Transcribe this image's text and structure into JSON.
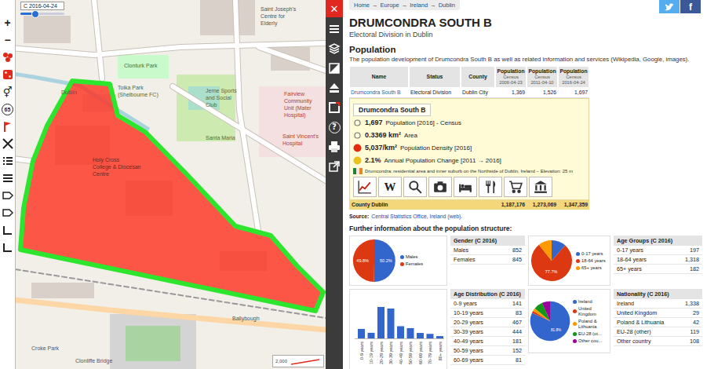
{
  "map": {
    "time_label": "C 2016-04-24",
    "time_level": 0.32,
    "inset_tick": "2,000",
    "tools": [
      {
        "kind": "zoom-in",
        "glyph": "+"
      },
      {
        "kind": "zoom-out",
        "glyph": "−"
      },
      {
        "kind": "markers"
      },
      {
        "kind": "grid"
      },
      {
        "kind": "gender",
        "glyph": "⚥"
      },
      {
        "kind": "age",
        "glyph": "65"
      },
      {
        "kind": "flag"
      },
      {
        "kind": "expand"
      },
      {
        "kind": "list"
      },
      {
        "kind": "menu"
      },
      {
        "kind": "tag"
      },
      {
        "kind": "tag"
      },
      {
        "kind": "corner"
      },
      {
        "kind": "corner"
      }
    ],
    "labels": [
      {
        "lines": [
          "Saint Joseph's",
          "Centre for",
          "Elderly"
        ],
        "color": "#555555"
      },
      {
        "lines": [
          "Clonturk Park"
        ],
        "color": "#4d6b4d"
      },
      {
        "lines": [
          "Tolka Park",
          "(Shelbourne FC)"
        ],
        "color": "#4d6b4d"
      },
      {
        "lines": [
          "Jerne Sports",
          "and Social",
          "Club"
        ],
        "color": "#4d6b4d"
      },
      {
        "lines": [
          "Fairview",
          "Community",
          "Unit (Mater",
          "Hospital)"
        ],
        "color": "#b0403a"
      },
      {
        "lines": [
          "Saint Vincent's",
          "Hospital"
        ],
        "color": "#b0403a"
      },
      {
        "lines": [
          "Santa Maria"
        ],
        "color": "#4d6b4d"
      },
      {
        "lines": [
          "Holy Cross",
          "College & Diocesan",
          "Centre"
        ],
        "color": "#6b2a20"
      },
      {
        "lines": [
          "Dublin"
        ],
        "color": "#555555"
      },
      {
        "lines": [
          "Croke Park"
        ],
        "color": "#555555"
      },
      {
        "lines": [
          "Clonliffe Bridge"
        ],
        "color": "#555555"
      },
      {
        "lines": [
          "Ballybough"
        ],
        "color": "#555555"
      }
    ]
  },
  "sidebar_tools": [
    {
      "kind": "close",
      "glyph": "✕"
    },
    {
      "kind": "menu"
    },
    {
      "kind": "layers"
    },
    {
      "kind": "contrast"
    },
    {
      "kind": "eject"
    },
    {
      "kind": "frame"
    },
    {
      "kind": "help",
      "glyph": "?"
    },
    {
      "kind": "print"
    },
    {
      "kind": "external"
    }
  ],
  "breadcrumb": {
    "items": [
      "Home",
      "Europe",
      "Ireland",
      "Dublin"
    ],
    "separator": "→"
  },
  "social": [
    {
      "kind": "twitter"
    },
    {
      "kind": "facebook",
      "glyph": "f"
    }
  ],
  "title": "DRUMCONDRA SOUTH B",
  "subtitle": "Electoral Division in Dublin",
  "section_title": "Population",
  "intro": "The population development of Drumcondra South B as well as related information and services (Wikipedia, Google, images).",
  "table": {
    "columns": [
      {
        "lines": [
          "Name"
        ]
      },
      {
        "lines": [
          "Status"
        ]
      },
      {
        "lines": [
          "County"
        ]
      },
      {
        "lines": [
          "Population",
          "Census",
          "2006-04-23"
        ]
      },
      {
        "lines": [
          "Population",
          "Census",
          "2011-04-10"
        ]
      },
      {
        "lines": [
          "Population",
          "Census",
          "2016-04-24"
        ]
      }
    ],
    "rows": [
      [
        "Drumcondra South B",
        "Electoral Division",
        "Dublin City",
        "1,369",
        "1,526",
        "1,697"
      ]
    ],
    "county_row": {
      "label": "County Dublin",
      "values": [
        "1,187,176",
        "1,273,069",
        "1,347,359"
      ]
    }
  },
  "card": {
    "title": "Drumcondra South B",
    "facts": [
      {
        "kind": "ring",
        "value": "1,697",
        "label": "Population [2016] - Census",
        "color": "#777777"
      },
      {
        "kind": "ring",
        "value": "0.3369 km²",
        "label": "Area",
        "color": "#777777"
      },
      {
        "kind": "dot",
        "value": "5,037/km²",
        "label": "Population Density [2016]",
        "color": "#e52b0e"
      },
      {
        "kind": "dot",
        "value": "2.1%",
        "label": "Annual Population Change [2011 → 2016]",
        "color": "#e8c21a"
      }
    ],
    "description": "Drumcondra: residential area and inner suburb on the Northside of Dublin, Ireland − Elevation: 25 m",
    "services": [
      {
        "kind": "chart"
      },
      {
        "kind": "wiki",
        "glyph": "W"
      },
      {
        "kind": "search"
      },
      {
        "kind": "camera"
      },
      {
        "kind": "hotel"
      },
      {
        "kind": "food"
      },
      {
        "kind": "shop"
      },
      {
        "kind": "museum"
      }
    ]
  },
  "source": {
    "label": "Source:",
    "text": "Central Statistics Office, Ireland (web)."
  },
  "further_title": "Further information about the population structure:",
  "stats": {
    "gender": {
      "title": "Gender (C 2016)",
      "rows": [
        {
          "label": "Males",
          "value": "852"
        },
        {
          "label": "Females",
          "value": "845"
        }
      ],
      "slices": [
        {
          "legend": "Males",
          "value": 852,
          "color": "#3366cc",
          "share": "50.2%"
        },
        {
          "legend": "Females",
          "value": 845,
          "color": "#dc3912",
          "share": "49.8%"
        }
      ]
    },
    "age_groups": {
      "title": "Age Groups (C 2016)",
      "rows": [
        {
          "label": "0-17 years",
          "value": "197"
        },
        {
          "label": "18-64 years",
          "value": "1,318"
        },
        {
          "label": "65+ years",
          "value": "182"
        }
      ],
      "slices": [
        {
          "legend": "0-17 years",
          "value": 197,
          "color": "#3366cc"
        },
        {
          "legend": "18-64 years",
          "value": 1318,
          "color": "#dc3912",
          "share": "77.7%"
        },
        {
          "legend": "65+ years",
          "value": 182,
          "color": "#ff9900"
        }
      ]
    },
    "age_distribution": {
      "title": "Age Distribution (C 2016)",
      "rows": [
        {
          "label": "0-9 years",
          "value": "141"
        },
        {
          "label": "10-19 years",
          "value": "83"
        },
        {
          "label": "20-29 years",
          "value": "467"
        },
        {
          "label": "30-39 years",
          "value": "444"
        },
        {
          "label": "40-49 years",
          "value": "181"
        },
        {
          "label": "50-59 years",
          "value": "152"
        },
        {
          "label": "60-69 years",
          "value": "81"
        }
      ],
      "chart": {
        "categories": [
          "0-9 years",
          "10-19 years",
          "20-29 years",
          "30-39 years",
          "40-49 years",
          "50-59 years",
          "60-69 years",
          "70-79 years",
          "80+ years"
        ],
        "values": [
          141,
          83,
          467,
          444,
          181,
          152,
          81,
          67,
          34
        ]
      }
    },
    "nationality": {
      "title": "Nationality (C 2016)",
      "rows": [
        {
          "label": "Ireland",
          "value": "1,338"
        },
        {
          "label": "United Kingdom",
          "value": "29"
        },
        {
          "label": "Poland & Lithuania",
          "value": "42"
        },
        {
          "label": "EU-28 (other)",
          "value": "119"
        },
        {
          "label": "Other country",
          "value": "108"
        }
      ],
      "slices": [
        {
          "legend": "Ireland",
          "value": 1338,
          "color": "#3366cc",
          "share": "81.8%"
        },
        {
          "legend": "United Kingdom",
          "value": 29,
          "color": "#dc3912"
        },
        {
          "legend": "Poland & Lithuania",
          "value": 42,
          "color": "#ff9900"
        },
        {
          "legend": "EU-28 (ot...",
          "value": 119,
          "color": "#109618"
        },
        {
          "legend": "Other cou...",
          "value": 108,
          "color": "#990099"
        }
      ]
    }
  }
}
